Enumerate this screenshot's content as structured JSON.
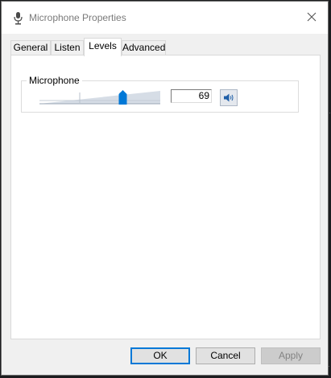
{
  "window": {
    "title": "Microphone Properties",
    "icon": "microphone-icon",
    "close_icon": "close-icon"
  },
  "tabs": [
    {
      "label": "General",
      "active": false
    },
    {
      "label": "Listen",
      "active": false
    },
    {
      "label": "Levels",
      "active": true
    },
    {
      "label": "Advanced",
      "active": false
    }
  ],
  "levels": {
    "group_label": "Microphone",
    "value": "69",
    "slider_percent": 69,
    "mute_icon": "speaker-icon"
  },
  "buttons": {
    "ok": "OK",
    "cancel": "Cancel",
    "apply": "Apply"
  },
  "colors": {
    "accent": "#0078d7",
    "window_bg": "#f0f0f0",
    "panel_bg": "#ffffff"
  }
}
